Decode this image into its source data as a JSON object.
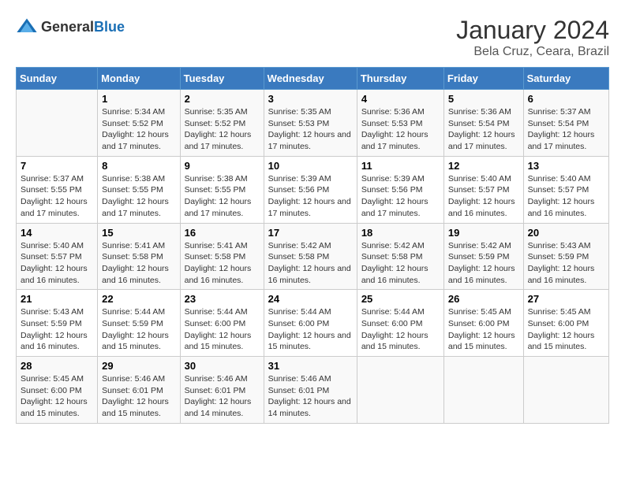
{
  "header": {
    "logo_general": "General",
    "logo_blue": "Blue",
    "month_title": "January 2024",
    "location": "Bela Cruz, Ceara, Brazil"
  },
  "days_of_week": [
    "Sunday",
    "Monday",
    "Tuesday",
    "Wednesday",
    "Thursday",
    "Friday",
    "Saturday"
  ],
  "weeks": [
    [
      {
        "day": "",
        "sunrise": "",
        "sunset": "",
        "daylight": ""
      },
      {
        "day": "1",
        "sunrise": "Sunrise: 5:34 AM",
        "sunset": "Sunset: 5:52 PM",
        "daylight": "Daylight: 12 hours and 17 minutes."
      },
      {
        "day": "2",
        "sunrise": "Sunrise: 5:35 AM",
        "sunset": "Sunset: 5:52 PM",
        "daylight": "Daylight: 12 hours and 17 minutes."
      },
      {
        "day": "3",
        "sunrise": "Sunrise: 5:35 AM",
        "sunset": "Sunset: 5:53 PM",
        "daylight": "Daylight: 12 hours and 17 minutes."
      },
      {
        "day": "4",
        "sunrise": "Sunrise: 5:36 AM",
        "sunset": "Sunset: 5:53 PM",
        "daylight": "Daylight: 12 hours and 17 minutes."
      },
      {
        "day": "5",
        "sunrise": "Sunrise: 5:36 AM",
        "sunset": "Sunset: 5:54 PM",
        "daylight": "Daylight: 12 hours and 17 minutes."
      },
      {
        "day": "6",
        "sunrise": "Sunrise: 5:37 AM",
        "sunset": "Sunset: 5:54 PM",
        "daylight": "Daylight: 12 hours and 17 minutes."
      }
    ],
    [
      {
        "day": "7",
        "sunrise": "Sunrise: 5:37 AM",
        "sunset": "Sunset: 5:55 PM",
        "daylight": "Daylight: 12 hours and 17 minutes."
      },
      {
        "day": "8",
        "sunrise": "Sunrise: 5:38 AM",
        "sunset": "Sunset: 5:55 PM",
        "daylight": "Daylight: 12 hours and 17 minutes."
      },
      {
        "day": "9",
        "sunrise": "Sunrise: 5:38 AM",
        "sunset": "Sunset: 5:55 PM",
        "daylight": "Daylight: 12 hours and 17 minutes."
      },
      {
        "day": "10",
        "sunrise": "Sunrise: 5:39 AM",
        "sunset": "Sunset: 5:56 PM",
        "daylight": "Daylight: 12 hours and 17 minutes."
      },
      {
        "day": "11",
        "sunrise": "Sunrise: 5:39 AM",
        "sunset": "Sunset: 5:56 PM",
        "daylight": "Daylight: 12 hours and 17 minutes."
      },
      {
        "day": "12",
        "sunrise": "Sunrise: 5:40 AM",
        "sunset": "Sunset: 5:57 PM",
        "daylight": "Daylight: 12 hours and 16 minutes."
      },
      {
        "day": "13",
        "sunrise": "Sunrise: 5:40 AM",
        "sunset": "Sunset: 5:57 PM",
        "daylight": "Daylight: 12 hours and 16 minutes."
      }
    ],
    [
      {
        "day": "14",
        "sunrise": "Sunrise: 5:40 AM",
        "sunset": "Sunset: 5:57 PM",
        "daylight": "Daylight: 12 hours and 16 minutes."
      },
      {
        "day": "15",
        "sunrise": "Sunrise: 5:41 AM",
        "sunset": "Sunset: 5:58 PM",
        "daylight": "Daylight: 12 hours and 16 minutes."
      },
      {
        "day": "16",
        "sunrise": "Sunrise: 5:41 AM",
        "sunset": "Sunset: 5:58 PM",
        "daylight": "Daylight: 12 hours and 16 minutes."
      },
      {
        "day": "17",
        "sunrise": "Sunrise: 5:42 AM",
        "sunset": "Sunset: 5:58 PM",
        "daylight": "Daylight: 12 hours and 16 minutes."
      },
      {
        "day": "18",
        "sunrise": "Sunrise: 5:42 AM",
        "sunset": "Sunset: 5:58 PM",
        "daylight": "Daylight: 12 hours and 16 minutes."
      },
      {
        "day": "19",
        "sunrise": "Sunrise: 5:42 AM",
        "sunset": "Sunset: 5:59 PM",
        "daylight": "Daylight: 12 hours and 16 minutes."
      },
      {
        "day": "20",
        "sunrise": "Sunrise: 5:43 AM",
        "sunset": "Sunset: 5:59 PM",
        "daylight": "Daylight: 12 hours and 16 minutes."
      }
    ],
    [
      {
        "day": "21",
        "sunrise": "Sunrise: 5:43 AM",
        "sunset": "Sunset: 5:59 PM",
        "daylight": "Daylight: 12 hours and 16 minutes."
      },
      {
        "day": "22",
        "sunrise": "Sunrise: 5:44 AM",
        "sunset": "Sunset: 5:59 PM",
        "daylight": "Daylight: 12 hours and 15 minutes."
      },
      {
        "day": "23",
        "sunrise": "Sunrise: 5:44 AM",
        "sunset": "Sunset: 6:00 PM",
        "daylight": "Daylight: 12 hours and 15 minutes."
      },
      {
        "day": "24",
        "sunrise": "Sunrise: 5:44 AM",
        "sunset": "Sunset: 6:00 PM",
        "daylight": "Daylight: 12 hours and 15 minutes."
      },
      {
        "day": "25",
        "sunrise": "Sunrise: 5:44 AM",
        "sunset": "Sunset: 6:00 PM",
        "daylight": "Daylight: 12 hours and 15 minutes."
      },
      {
        "day": "26",
        "sunrise": "Sunrise: 5:45 AM",
        "sunset": "Sunset: 6:00 PM",
        "daylight": "Daylight: 12 hours and 15 minutes."
      },
      {
        "day": "27",
        "sunrise": "Sunrise: 5:45 AM",
        "sunset": "Sunset: 6:00 PM",
        "daylight": "Daylight: 12 hours and 15 minutes."
      }
    ],
    [
      {
        "day": "28",
        "sunrise": "Sunrise: 5:45 AM",
        "sunset": "Sunset: 6:00 PM",
        "daylight": "Daylight: 12 hours and 15 minutes."
      },
      {
        "day": "29",
        "sunrise": "Sunrise: 5:46 AM",
        "sunset": "Sunset: 6:01 PM",
        "daylight": "Daylight: 12 hours and 15 minutes."
      },
      {
        "day": "30",
        "sunrise": "Sunrise: 5:46 AM",
        "sunset": "Sunset: 6:01 PM",
        "daylight": "Daylight: 12 hours and 14 minutes."
      },
      {
        "day": "31",
        "sunrise": "Sunrise: 5:46 AM",
        "sunset": "Sunset: 6:01 PM",
        "daylight": "Daylight: 12 hours and 14 minutes."
      },
      {
        "day": "",
        "sunrise": "",
        "sunset": "",
        "daylight": ""
      },
      {
        "day": "",
        "sunrise": "",
        "sunset": "",
        "daylight": ""
      },
      {
        "day": "",
        "sunrise": "",
        "sunset": "",
        "daylight": ""
      }
    ]
  ]
}
